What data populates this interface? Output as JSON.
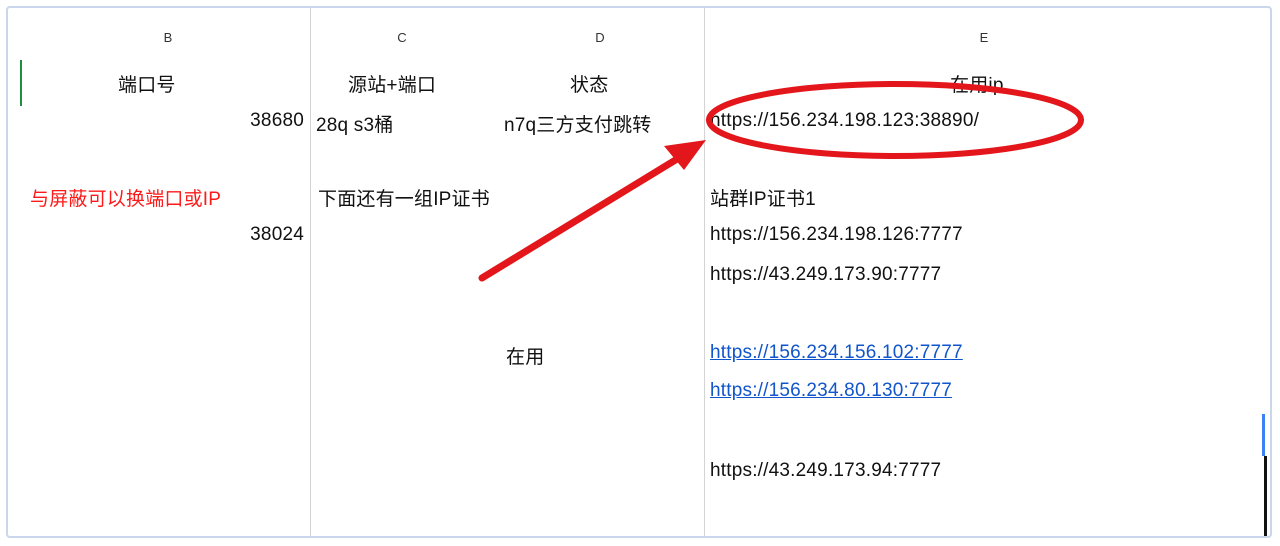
{
  "columns": {
    "b": "B",
    "c1": "C",
    "c2": "D",
    "e": "E"
  },
  "headers": {
    "port": "端口号",
    "source_port": "源站+端口",
    "status": "状态",
    "ip_in_use": "在用ip"
  },
  "rows": {
    "r1_port": "38680",
    "r1_source": "28q s3桶",
    "r1_status": "n7q三方支付跳转",
    "r1_ip": "https://156.234.198.123:38890/",
    "note_red": "与屏蔽可以换端口或IP",
    "r2_port": "38024",
    "r2_source": "下面还有一组IP证书",
    "group_label": "站群IP证书1",
    "ip_a": "https://156.234.198.126:7777",
    "ip_b": "https://43.249.173.90:7777",
    "in_use_label": "在用",
    "ip_link1": "https://156.234.156.102:7777",
    "ip_link2": "https://156.234.80.130:7777",
    "ip_c": "https://43.249.173.94:7777"
  },
  "annotation": {
    "stroke_color": "#e3161b"
  }
}
